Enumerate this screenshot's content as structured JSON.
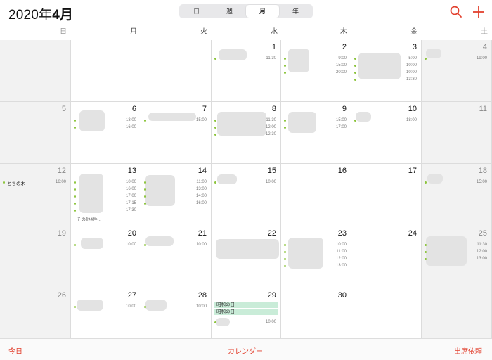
{
  "header": {
    "year_label": "2020年",
    "month_label": "4月",
    "view_tabs": [
      "日",
      "週",
      "月",
      "年"
    ]
  },
  "weekdays": [
    "日",
    "月",
    "火",
    "水",
    "木",
    "金",
    "土"
  ],
  "weeks": [
    [
      {
        "day": ""
      },
      {
        "day": ""
      },
      {
        "day": ""
      },
      {
        "day": "1",
        "events": [
          {
            "time": "11:30"
          }
        ]
      },
      {
        "day": "2",
        "events": [
          {
            "time": "9:00"
          },
          {
            "time": "15:00"
          },
          {
            "time": "20:00"
          }
        ]
      },
      {
        "day": "3",
        "events": [
          {
            "time": "5:00"
          },
          {
            "time": "10:00"
          },
          {
            "time": "10:00"
          },
          {
            "time": "13:30"
          }
        ]
      },
      {
        "day": "4",
        "events": [
          {
            "time": "19:00"
          }
        ]
      }
    ],
    [
      {
        "day": "5"
      },
      {
        "day": "6",
        "events": [
          {
            "time": "13:00"
          },
          {
            "time": "16:00"
          }
        ]
      },
      {
        "day": "7",
        "events": [
          {
            "time": "15:00"
          }
        ]
      },
      {
        "day": "8",
        "events": [
          {
            "time": "11:30"
          },
          {
            "time": "12:00"
          },
          {
            "time": "12:30"
          }
        ]
      },
      {
        "day": "9",
        "events": [
          {
            "time": "15:00"
          },
          {
            "time": "17:00"
          }
        ]
      },
      {
        "day": "10",
        "events": [
          {
            "time": "18:00"
          }
        ]
      },
      {
        "day": "11"
      }
    ],
    [
      {
        "day": "12",
        "events": [
          {
            "name": "とちの木",
            "time": "16:00"
          }
        ]
      },
      {
        "day": "13",
        "events": [
          {
            "time": "10:00"
          },
          {
            "time": "16:00"
          },
          {
            "time": "17:00"
          },
          {
            "time": "17:15"
          },
          {
            "time": "17:30"
          }
        ],
        "more": "その他4件..."
      },
      {
        "day": "14",
        "events": [
          {
            "time": "11:00"
          },
          {
            "time": "13:00"
          },
          {
            "time": "14:00"
          },
          {
            "time": "16:00"
          }
        ]
      },
      {
        "day": "15",
        "events": [
          {
            "time": "10:00"
          }
        ]
      },
      {
        "day": "16"
      },
      {
        "day": "17"
      },
      {
        "day": "18",
        "events": [
          {
            "time": "15:00"
          }
        ]
      }
    ],
    [
      {
        "day": "19"
      },
      {
        "day": "20",
        "events": [
          {
            "time": "10:00"
          }
        ]
      },
      {
        "day": "21",
        "events": [
          {
            "time": "10:00"
          }
        ]
      },
      {
        "day": "22"
      },
      {
        "day": "23",
        "events": [
          {
            "time": "10:00"
          },
          {
            "time": "11:00"
          },
          {
            "time": "12:00"
          },
          {
            "time": "13:00"
          }
        ]
      },
      {
        "day": "24"
      },
      {
        "day": "25",
        "events": [
          {
            "time": "11:30"
          },
          {
            "time": "12:00"
          },
          {
            "time": "13:00"
          }
        ]
      }
    ],
    [
      {
        "day": "26"
      },
      {
        "day": "27",
        "events": [
          {
            "time": "10:00"
          }
        ]
      },
      {
        "day": "28",
        "events": [
          {
            "time": "10:00"
          }
        ]
      },
      {
        "day": "29",
        "holidays": [
          "昭和の日",
          "昭和の日"
        ],
        "events": [
          {
            "time": "10:00"
          }
        ]
      },
      {
        "day": "30"
      },
      {
        "day": ""
      },
      {
        "day": ""
      }
    ]
  ],
  "footer": {
    "today": "今日",
    "calendars": "カレンダー",
    "inbox": "出席依頼"
  },
  "colors": {
    "accent": "#e2402e",
    "event_dot": "#8cc43c",
    "holiday_bg": "#c9ecd8",
    "weekend_bg": "#f2f2f2"
  }
}
